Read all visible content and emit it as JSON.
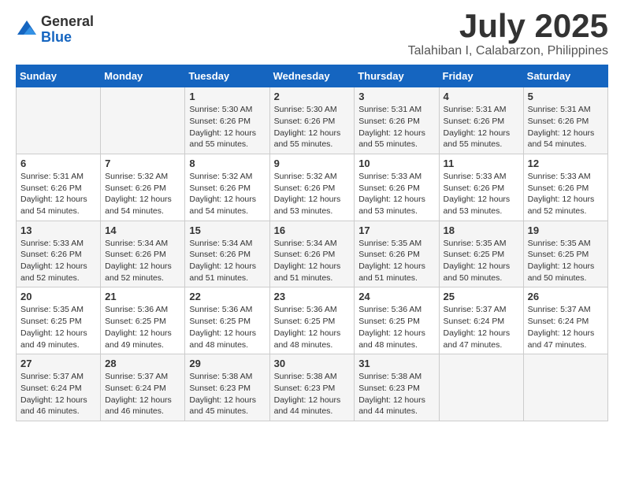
{
  "header": {
    "logo": {
      "general": "General",
      "blue": "Blue"
    },
    "title": "July 2025",
    "location": "Talahiban I, Calabarzon, Philippines"
  },
  "weekdays": [
    "Sunday",
    "Monday",
    "Tuesday",
    "Wednesday",
    "Thursday",
    "Friday",
    "Saturday"
  ],
  "weeks": [
    [
      {
        "day": "",
        "sunrise": "",
        "sunset": "",
        "daylight": ""
      },
      {
        "day": "",
        "sunrise": "",
        "sunset": "",
        "daylight": ""
      },
      {
        "day": "1",
        "sunrise": "Sunrise: 5:30 AM",
        "sunset": "Sunset: 6:26 PM",
        "daylight": "Daylight: 12 hours and 55 minutes."
      },
      {
        "day": "2",
        "sunrise": "Sunrise: 5:30 AM",
        "sunset": "Sunset: 6:26 PM",
        "daylight": "Daylight: 12 hours and 55 minutes."
      },
      {
        "day": "3",
        "sunrise": "Sunrise: 5:31 AM",
        "sunset": "Sunset: 6:26 PM",
        "daylight": "Daylight: 12 hours and 55 minutes."
      },
      {
        "day": "4",
        "sunrise": "Sunrise: 5:31 AM",
        "sunset": "Sunset: 6:26 PM",
        "daylight": "Daylight: 12 hours and 55 minutes."
      },
      {
        "day": "5",
        "sunrise": "Sunrise: 5:31 AM",
        "sunset": "Sunset: 6:26 PM",
        "daylight": "Daylight: 12 hours and 54 minutes."
      }
    ],
    [
      {
        "day": "6",
        "sunrise": "Sunrise: 5:31 AM",
        "sunset": "Sunset: 6:26 PM",
        "daylight": "Daylight: 12 hours and 54 minutes."
      },
      {
        "day": "7",
        "sunrise": "Sunrise: 5:32 AM",
        "sunset": "Sunset: 6:26 PM",
        "daylight": "Daylight: 12 hours and 54 minutes."
      },
      {
        "day": "8",
        "sunrise": "Sunrise: 5:32 AM",
        "sunset": "Sunset: 6:26 PM",
        "daylight": "Daylight: 12 hours and 54 minutes."
      },
      {
        "day": "9",
        "sunrise": "Sunrise: 5:32 AM",
        "sunset": "Sunset: 6:26 PM",
        "daylight": "Daylight: 12 hours and 53 minutes."
      },
      {
        "day": "10",
        "sunrise": "Sunrise: 5:33 AM",
        "sunset": "Sunset: 6:26 PM",
        "daylight": "Daylight: 12 hours and 53 minutes."
      },
      {
        "day": "11",
        "sunrise": "Sunrise: 5:33 AM",
        "sunset": "Sunset: 6:26 PM",
        "daylight": "Daylight: 12 hours and 53 minutes."
      },
      {
        "day": "12",
        "sunrise": "Sunrise: 5:33 AM",
        "sunset": "Sunset: 6:26 PM",
        "daylight": "Daylight: 12 hours and 52 minutes."
      }
    ],
    [
      {
        "day": "13",
        "sunrise": "Sunrise: 5:33 AM",
        "sunset": "Sunset: 6:26 PM",
        "daylight": "Daylight: 12 hours and 52 minutes."
      },
      {
        "day": "14",
        "sunrise": "Sunrise: 5:34 AM",
        "sunset": "Sunset: 6:26 PM",
        "daylight": "Daylight: 12 hours and 52 minutes."
      },
      {
        "day": "15",
        "sunrise": "Sunrise: 5:34 AM",
        "sunset": "Sunset: 6:26 PM",
        "daylight": "Daylight: 12 hours and 51 minutes."
      },
      {
        "day": "16",
        "sunrise": "Sunrise: 5:34 AM",
        "sunset": "Sunset: 6:26 PM",
        "daylight": "Daylight: 12 hours and 51 minutes."
      },
      {
        "day": "17",
        "sunrise": "Sunrise: 5:35 AM",
        "sunset": "Sunset: 6:26 PM",
        "daylight": "Daylight: 12 hours and 51 minutes."
      },
      {
        "day": "18",
        "sunrise": "Sunrise: 5:35 AM",
        "sunset": "Sunset: 6:25 PM",
        "daylight": "Daylight: 12 hours and 50 minutes."
      },
      {
        "day": "19",
        "sunrise": "Sunrise: 5:35 AM",
        "sunset": "Sunset: 6:25 PM",
        "daylight": "Daylight: 12 hours and 50 minutes."
      }
    ],
    [
      {
        "day": "20",
        "sunrise": "Sunrise: 5:35 AM",
        "sunset": "Sunset: 6:25 PM",
        "daylight": "Daylight: 12 hours and 49 minutes."
      },
      {
        "day": "21",
        "sunrise": "Sunrise: 5:36 AM",
        "sunset": "Sunset: 6:25 PM",
        "daylight": "Daylight: 12 hours and 49 minutes."
      },
      {
        "day": "22",
        "sunrise": "Sunrise: 5:36 AM",
        "sunset": "Sunset: 6:25 PM",
        "daylight": "Daylight: 12 hours and 48 minutes."
      },
      {
        "day": "23",
        "sunrise": "Sunrise: 5:36 AM",
        "sunset": "Sunset: 6:25 PM",
        "daylight": "Daylight: 12 hours and 48 minutes."
      },
      {
        "day": "24",
        "sunrise": "Sunrise: 5:36 AM",
        "sunset": "Sunset: 6:25 PM",
        "daylight": "Daylight: 12 hours and 48 minutes."
      },
      {
        "day": "25",
        "sunrise": "Sunrise: 5:37 AM",
        "sunset": "Sunset: 6:24 PM",
        "daylight": "Daylight: 12 hours and 47 minutes."
      },
      {
        "day": "26",
        "sunrise": "Sunrise: 5:37 AM",
        "sunset": "Sunset: 6:24 PM",
        "daylight": "Daylight: 12 hours and 47 minutes."
      }
    ],
    [
      {
        "day": "27",
        "sunrise": "Sunrise: 5:37 AM",
        "sunset": "Sunset: 6:24 PM",
        "daylight": "Daylight: 12 hours and 46 minutes."
      },
      {
        "day": "28",
        "sunrise": "Sunrise: 5:37 AM",
        "sunset": "Sunset: 6:24 PM",
        "daylight": "Daylight: 12 hours and 46 minutes."
      },
      {
        "day": "29",
        "sunrise": "Sunrise: 5:38 AM",
        "sunset": "Sunset: 6:23 PM",
        "daylight": "Daylight: 12 hours and 45 minutes."
      },
      {
        "day": "30",
        "sunrise": "Sunrise: 5:38 AM",
        "sunset": "Sunset: 6:23 PM",
        "daylight": "Daylight: 12 hours and 44 minutes."
      },
      {
        "day": "31",
        "sunrise": "Sunrise: 5:38 AM",
        "sunset": "Sunset: 6:23 PM",
        "daylight": "Daylight: 12 hours and 44 minutes."
      },
      {
        "day": "",
        "sunrise": "",
        "sunset": "",
        "daylight": ""
      },
      {
        "day": "",
        "sunrise": "",
        "sunset": "",
        "daylight": ""
      }
    ]
  ]
}
